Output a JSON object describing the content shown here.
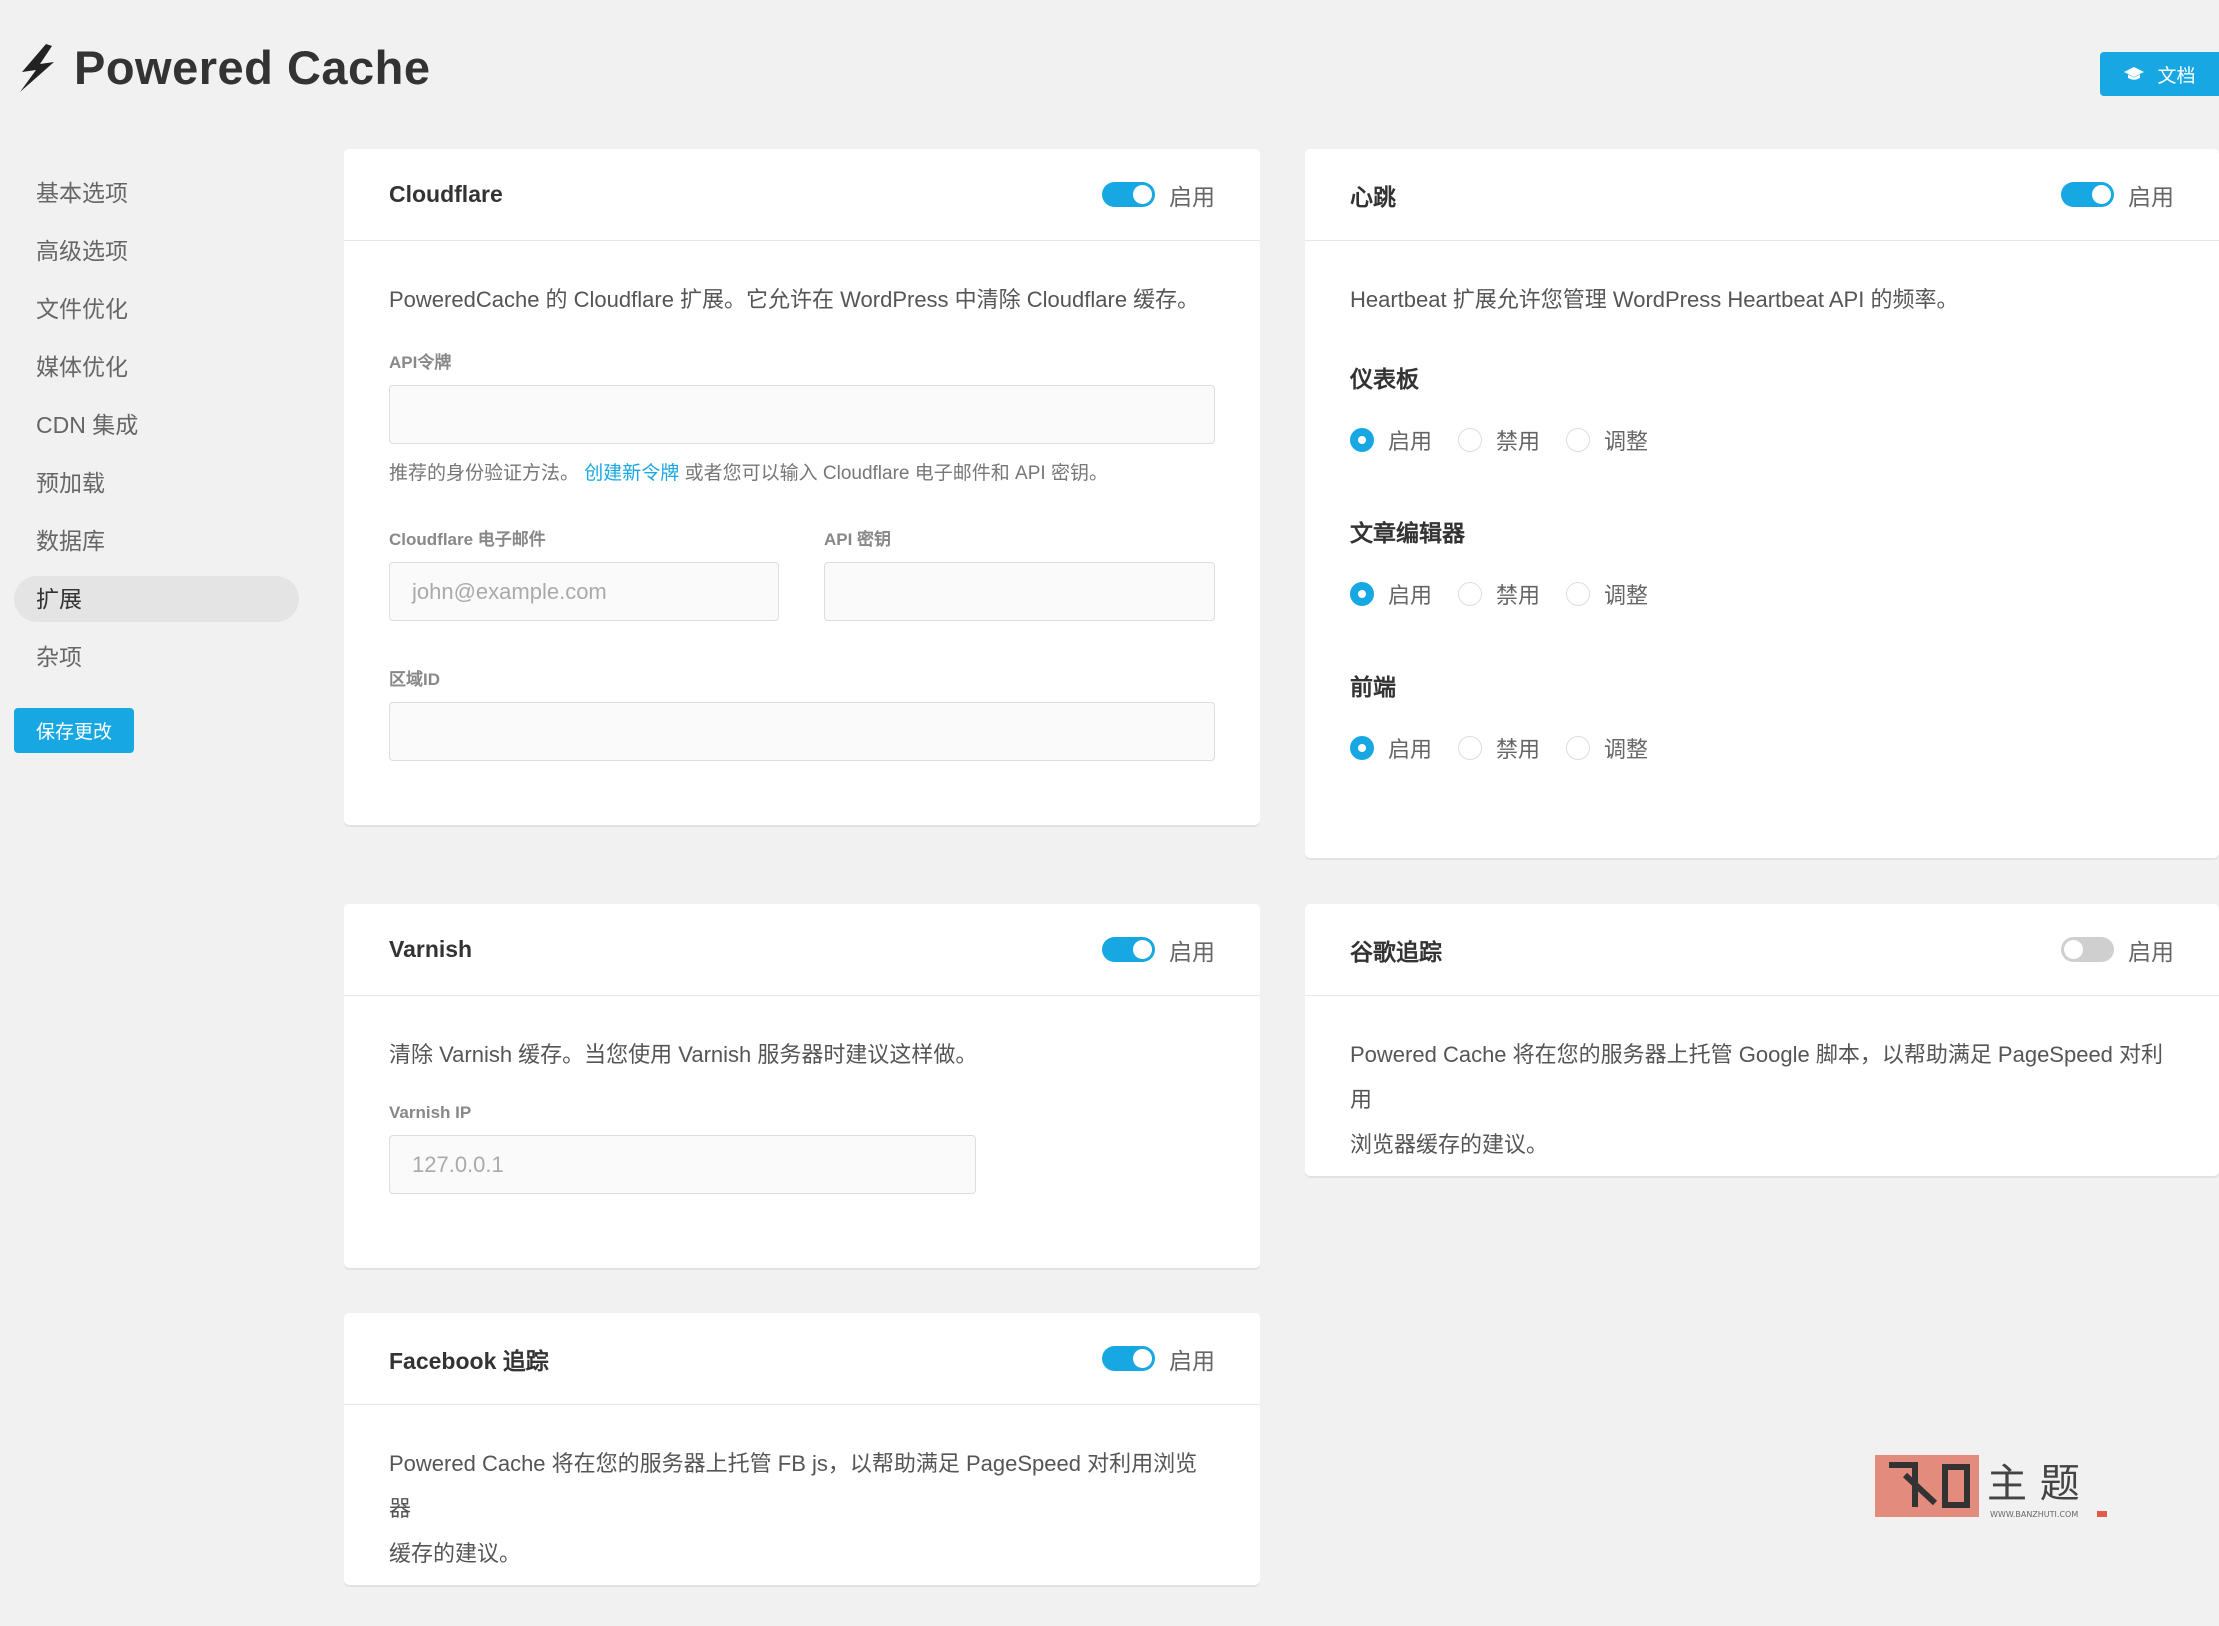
{
  "app": {
    "title": "Powered Cache",
    "docs_label": "文档"
  },
  "sidebar": {
    "items": [
      {
        "label": "基本选项"
      },
      {
        "label": "高级选项"
      },
      {
        "label": "文件优化"
      },
      {
        "label": "媒体优化"
      },
      {
        "label": "CDN 集成"
      },
      {
        "label": "预加载"
      },
      {
        "label": "数据库"
      },
      {
        "label": "扩展",
        "active": true
      },
      {
        "label": "杂项"
      }
    ],
    "save_label": "保存更改"
  },
  "cloudflare": {
    "title": "Cloudflare",
    "toggle_label": "启用",
    "enabled": true,
    "description": "PoweredCache 的 Cloudflare 扩展。它允许在 WordPress 中清除 Cloudflare 缓存。",
    "api_token_label": "API令牌",
    "api_token_value": "",
    "help_prefix": "推荐的身份验证方法。",
    "help_link": "创建新令牌",
    "help_suffix": "或者您可以输入 Cloudflare 电子邮件和 API 密钥。",
    "email_label": "Cloudflare 电子邮件",
    "email_placeholder": "john@example.com",
    "api_key_label": "API 密钥",
    "api_key_value": "",
    "zone_label": "区域ID",
    "zone_value": ""
  },
  "heartbeat": {
    "title": "心跳",
    "toggle_label": "启用",
    "enabled": true,
    "description": "Heartbeat 扩展允许您管理 WordPress Heartbeat API 的频率。",
    "sections": [
      {
        "title": "仪表板",
        "options": [
          "启用",
          "禁用",
          "调整"
        ],
        "selected": "启用"
      },
      {
        "title": "文章编辑器",
        "options": [
          "启用",
          "禁用",
          "调整"
        ],
        "selected": "启用"
      },
      {
        "title": "前端",
        "options": [
          "启用",
          "禁用",
          "调整"
        ],
        "selected": "启用"
      }
    ]
  },
  "varnish": {
    "title": "Varnish",
    "toggle_label": "启用",
    "enabled": true,
    "description": "清除 Varnish 缓存。当您使用 Varnish 服务器时建议这样做。",
    "ip_label": "Varnish IP",
    "ip_placeholder": "127.0.0.1"
  },
  "google": {
    "title": "谷歌追踪",
    "toggle_label": "启用",
    "enabled": false,
    "description_line1": "Powered Cache 将在您的服务器上托管 Google 脚本，以帮助满足 PageSpeed 对利用",
    "description_line2": "浏览器缓存的建议。"
  },
  "facebook": {
    "title": "Facebook 追踪",
    "toggle_label": "启用",
    "enabled": true,
    "description_line1": "Powered Cache 将在您的服务器上托管 FB js，以帮助满足 PageSpeed 对利用浏览器",
    "description_line2": "缓存的建议。"
  },
  "watermark": {
    "text": "主 题",
    "url": "WWW.BANZHUTI.COM"
  },
  "colors": {
    "accent": "#17a8e3",
    "background": "#f1f1f1"
  }
}
